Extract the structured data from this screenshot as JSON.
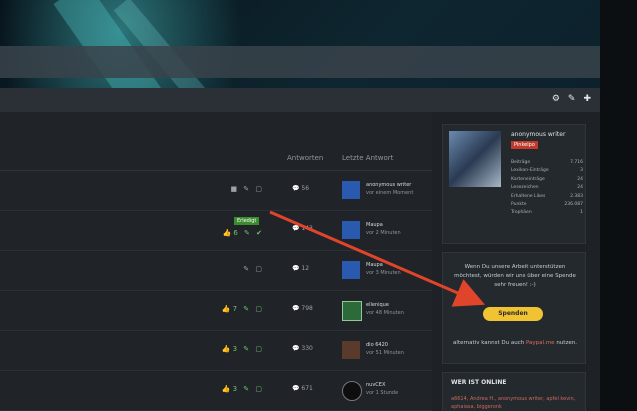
{
  "nav": {
    "icons": [
      "gear-icon",
      "edit-icon",
      "plus-icon"
    ]
  },
  "table": {
    "headers": {
      "answers": "Antworten",
      "last_answer": "Letzte Antwort"
    },
    "rows": [
      {
        "replies": "56",
        "last_user": "anonymous writer",
        "last_time": "vor einem Moment",
        "icons": "■ ✎ ▢",
        "avatar": "blue"
      },
      {
        "badge": "Erledigt",
        "stats": "👍6 ✎ ✔",
        "replies": "143",
        "last_user": "Maupa",
        "last_time": "vor 2 Minuten",
        "avatar": "blue"
      },
      {
        "replies": "12",
        "last_user": "Maupa",
        "last_time": "vor 3 Minuten",
        "icons": "✎ ▢",
        "avatar": "blue"
      },
      {
        "stats": "👍7 ✎ ▢",
        "replies": "798",
        "last_user": "ellenique",
        "last_time": "vor 48 Minuten",
        "avatar": "green"
      },
      {
        "stats": "👍3 ✎ ▢",
        "replies": "330",
        "last_user": "dio 6420",
        "last_time": "vor 51 Minuten",
        "avatar": "dark"
      },
      {
        "stats": "👍3 ✎ ▢",
        "replies": "671",
        "last_user": "nuvCEX",
        "last_time": "vor 1 Stunde",
        "avatar": "round"
      }
    ]
  },
  "sidebar": {
    "profile": {
      "name": "anonymous writer",
      "rank": "Pinkelpo",
      "stats": [
        {
          "label": "Beiträge",
          "value": "7.716"
        },
        {
          "label": "Lexikon-Einträge",
          "value": "3"
        },
        {
          "label": "Karteneinträge",
          "value": "24"
        },
        {
          "label": "Lesezeichen",
          "value": "24"
        },
        {
          "label": "Erhaltene Likes",
          "value": "2.383"
        },
        {
          "label": "Punkte",
          "value": "236.087"
        },
        {
          "label": "Trophäen",
          "value": "1"
        }
      ]
    },
    "donate": {
      "text": "Wenn Du unsere Arbeit unterstützen möchtest, würden wir uns über eine Spende sehr freuen! :-)",
      "button": "Spenden",
      "alt_prefix": "alternativ kannst Du auch",
      "alt_link": "Paypal.me",
      "alt_suffix": "nutzen."
    },
    "online": {
      "title": "WER IST ONLINE",
      "list": "a6614, Andrea H., anonymous writer, apfel kevin, aphaiasa, biggeronk"
    }
  },
  "colors": {
    "accent_button": "#f1c232",
    "badge_green": "#3b8b2f",
    "rank_red": "#c0392b",
    "arrow_red": "#e0442a"
  }
}
